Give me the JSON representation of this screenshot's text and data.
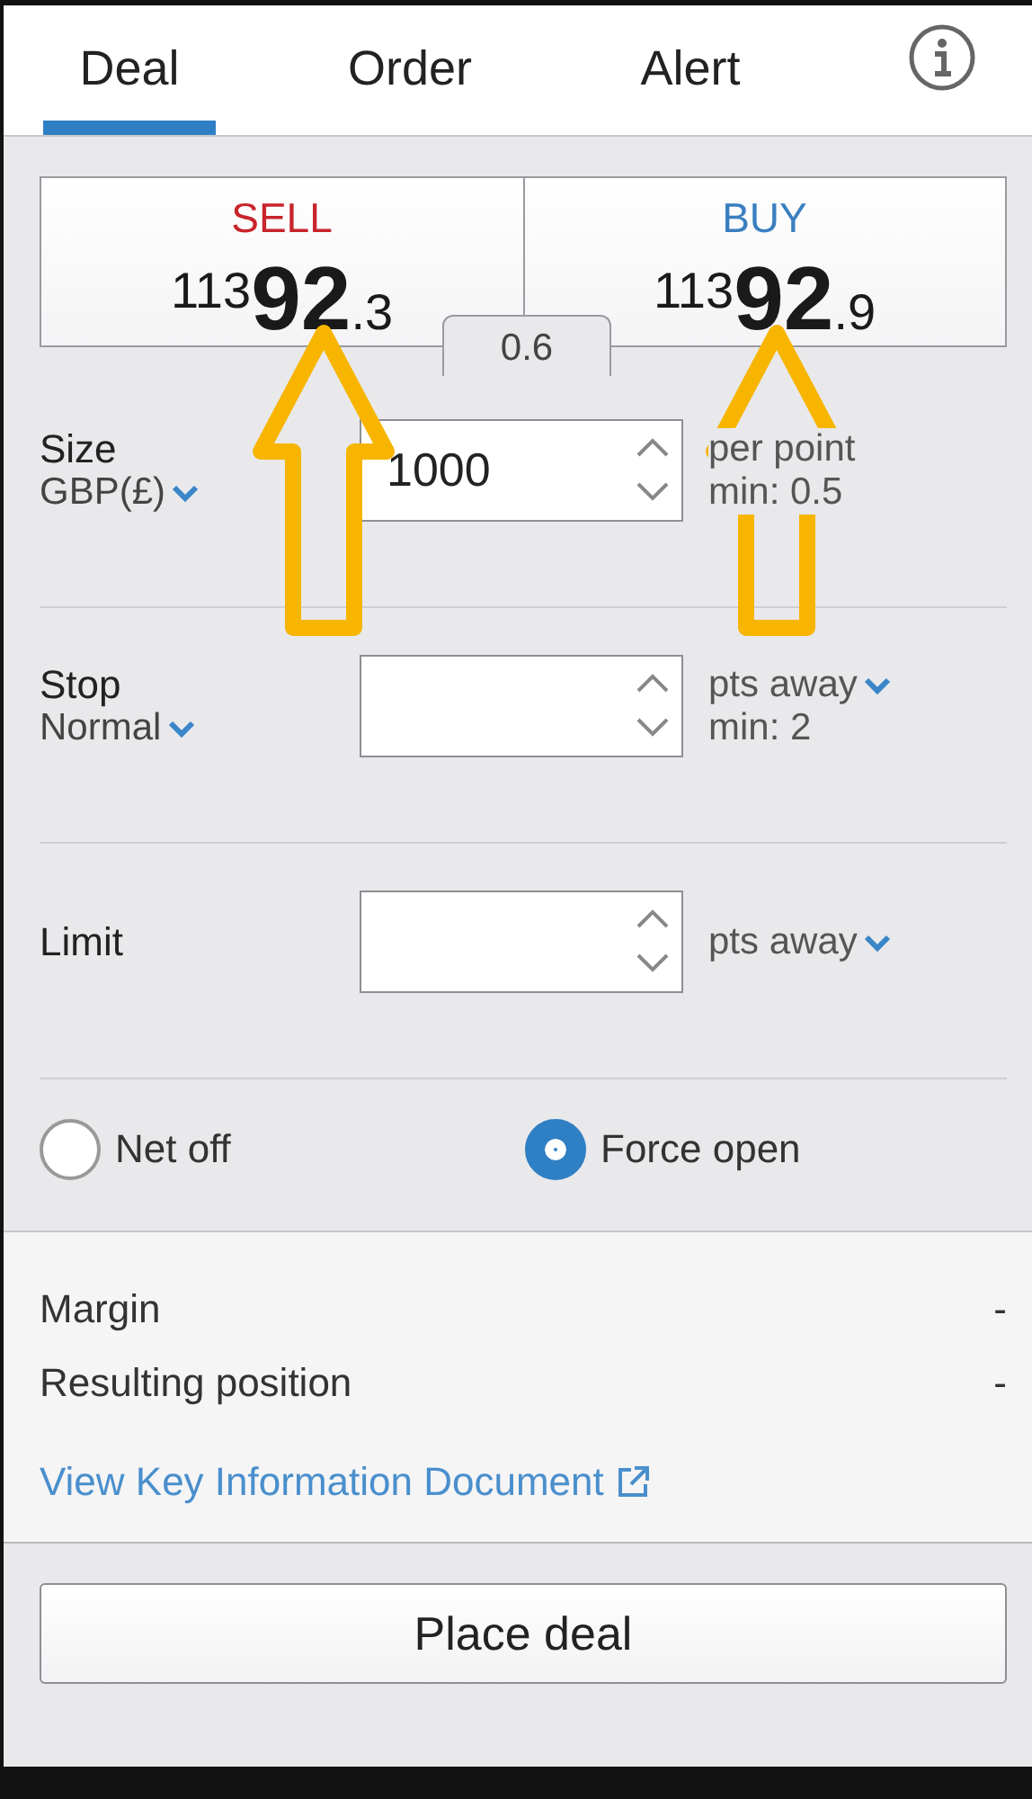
{
  "tabs": [
    {
      "label": "Deal",
      "selected": true
    },
    {
      "label": "Order",
      "selected": false
    },
    {
      "label": "Alert",
      "selected": false
    }
  ],
  "quote": {
    "sell": {
      "label": "SELL",
      "price_big_figure": "113",
      "price_pips": "92",
      "price_fraction": ".3"
    },
    "buy": {
      "label": "BUY",
      "price_big_figure": "113",
      "price_pips": "92",
      "price_fraction": ".9"
    },
    "spread": "0.6"
  },
  "fields": [
    {
      "label": "Size",
      "selector": "GBP(£)",
      "value": "1000",
      "unit": "per point",
      "unit_dropdown": false,
      "minimum": "min: 0.5"
    },
    {
      "label": "Stop",
      "selector": "Normal",
      "unit": "pts away",
      "unit_dropdown": true,
      "minimum": "min: 2"
    },
    {
      "label": "Limit",
      "unit": "pts away",
      "unit_dropdown": true
    }
  ],
  "position_mode": [
    {
      "label": "Net off",
      "selected": false
    },
    {
      "label": "Force open",
      "selected": true
    }
  ],
  "summary": [
    {
      "label": "Margin",
      "value": "-"
    },
    {
      "label": "Resulting position",
      "value": "-"
    }
  ],
  "link": "View Key Information Document",
  "action": "Place deal"
}
